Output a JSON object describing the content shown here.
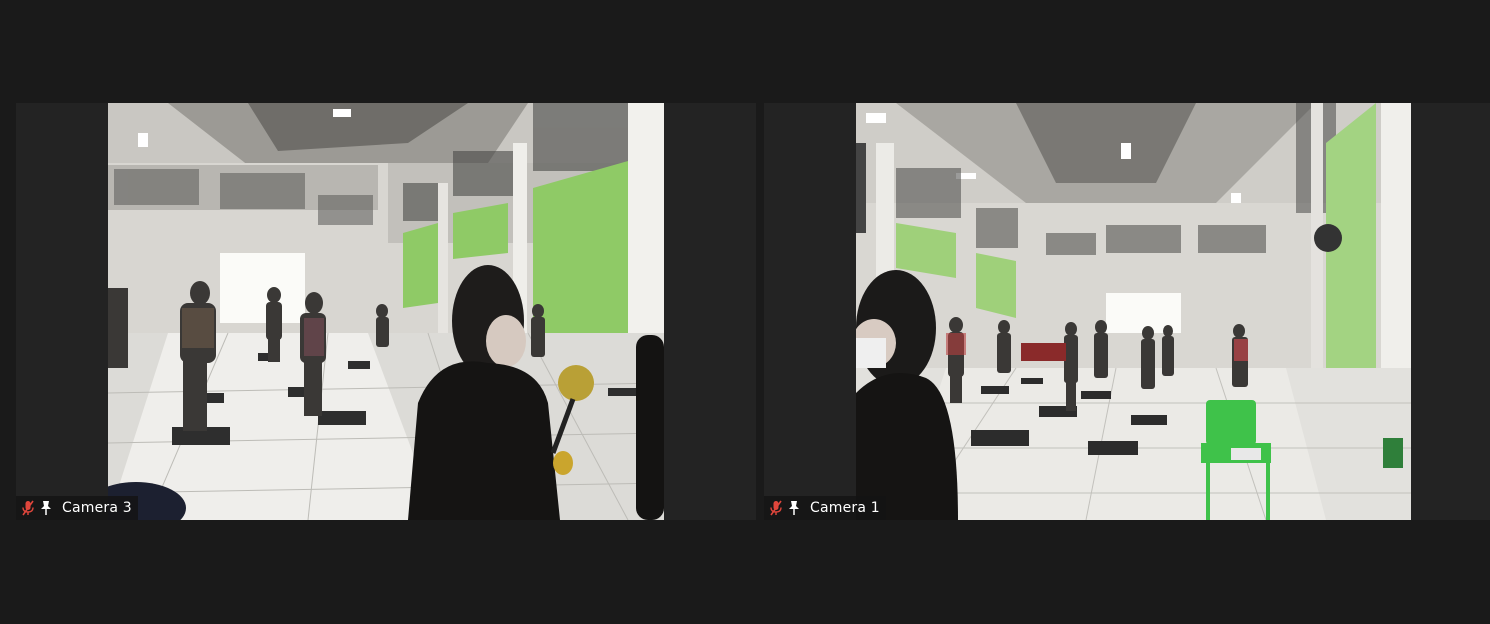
{
  "participants": [
    {
      "name": "Camera 3",
      "audio": "muted",
      "pinned": true
    },
    {
      "name": "Camera 1",
      "audio": "muted",
      "pinned": true
    }
  ],
  "colors": {
    "background": "#1a1a1a",
    "tile_background": "#232323",
    "mute_icon": "#e0463c",
    "label_text": "#ffffff"
  },
  "icons": {
    "mute": "mic-muted-icon",
    "pin": "pin-icon"
  }
}
